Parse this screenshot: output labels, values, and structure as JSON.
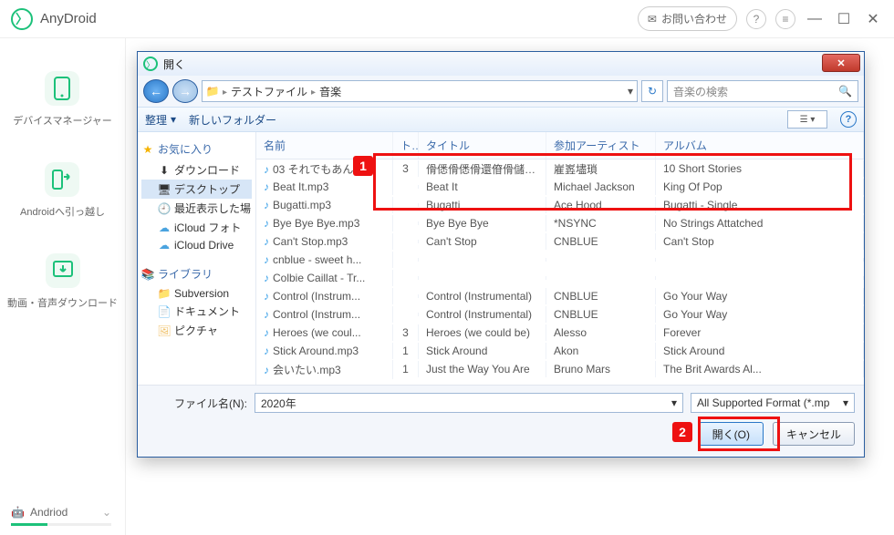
{
  "app": {
    "title": "AnyDroid",
    "contact_label": "お問い合わせ"
  },
  "sidebar": {
    "items": [
      {
        "label": "デバイスマネージャー"
      },
      {
        "label": "Androidへ引っ越し"
      },
      {
        "label": "動画・音声ダウンロード"
      }
    ],
    "device": "Andriod"
  },
  "dialog": {
    "title": "開く",
    "crumbs": [
      "テストファイル",
      "音楽"
    ],
    "search_placeholder": "音楽の検索",
    "toolbar": {
      "organize": "整理",
      "new_folder": "新しいフォルダー"
    },
    "tree": {
      "favorites": "お気に入り",
      "fav_items": [
        "ダウンロード",
        "デスクトップ",
        "最近表示した場",
        "iCloud フォト",
        "iCloud Drive"
      ],
      "libraries": "ライブラリ",
      "lib_items": [
        "Subversion",
        "ドキュメント",
        "ピクチャ"
      ]
    },
    "columns": {
      "name": "名前",
      "track": "ト...",
      "title": "タイトル",
      "artist": "参加アーティスト",
      "album": "アルバム"
    },
    "rows": [
      {
        "name": "03 それでもあんた...",
        "track": "3",
        "title": "傦僁傦僁傦還傄傦儲傦儖...",
        "artist": "嵟嶳壗瑣",
        "album": "10 Short Stories"
      },
      {
        "name": "Beat It.mp3",
        "track": "",
        "title": "Beat It",
        "artist": "Michael Jackson",
        "album": "King Of Pop"
      },
      {
        "name": "Bugatti.mp3",
        "track": "",
        "title": "Bugatti",
        "artist": "Ace Hood",
        "album": "Bugatti - Single"
      },
      {
        "name": "Bye Bye Bye.mp3",
        "track": "",
        "title": "Bye Bye Bye",
        "artist": "*NSYNC",
        "album": "No Strings Attatched"
      },
      {
        "name": "Can't Stop.mp3",
        "track": "",
        "title": "Can't Stop",
        "artist": "CNBLUE",
        "album": "Can't Stop"
      },
      {
        "name": "cnblue - sweet h...",
        "track": "",
        "title": "",
        "artist": "",
        "album": ""
      },
      {
        "name": "Colbie Caillat - Tr...",
        "track": "",
        "title": "",
        "artist": "",
        "album": ""
      },
      {
        "name": "Control (Instrum...",
        "track": "",
        "title": "Control (Instrumental)",
        "artist": "CNBLUE",
        "album": "Go Your Way"
      },
      {
        "name": "Control (Instrum...",
        "track": "",
        "title": "Control (Instrumental)",
        "artist": "CNBLUE",
        "album": "Go Your Way"
      },
      {
        "name": "Heroes (we coul...",
        "track": "3",
        "title": "Heroes (we could be)",
        "artist": "Alesso",
        "album": "Forever"
      },
      {
        "name": "Stick Around.mp3",
        "track": "1",
        "title": "Stick Around",
        "artist": "Akon",
        "album": "Stick Around"
      },
      {
        "name": "会いたい.mp3",
        "track": "1",
        "title": "Just the Way You Are",
        "artist": "Bruno Mars",
        "album": "The Brit Awards Al..."
      }
    ],
    "filename_label": "ファイル名(N):",
    "filename_value": "2020年",
    "filter_label": "All Supported Format (*.mp",
    "open_btn": "開く(O)",
    "cancel_btn": "キャンセル"
  },
  "callouts": {
    "one": "1",
    "two": "2"
  }
}
